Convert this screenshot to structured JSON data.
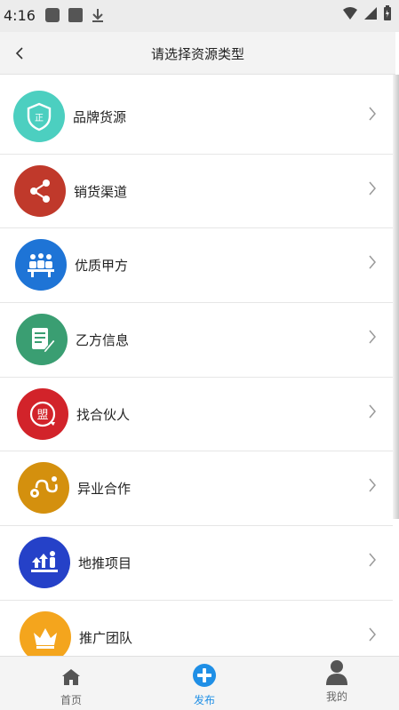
{
  "status_bar": {
    "time": "4:16"
  },
  "header": {
    "title": "请选择资源类型"
  },
  "items": [
    {
      "label": "品牌货源",
      "icon": "shield-certified-icon",
      "color": "#4ccfc0"
    },
    {
      "label": "销货渠道",
      "icon": "share-icon",
      "color": "#c0392b"
    },
    {
      "label": "优质甲方",
      "icon": "team-meeting-icon",
      "color": "#1e74d6"
    },
    {
      "label": "乙方信息",
      "icon": "document-edit-icon",
      "color": "#3a9e72"
    },
    {
      "label": "找合伙人",
      "icon": "alliance-seal-icon",
      "color": "#d2232a"
    },
    {
      "label": "异业合作",
      "icon": "route-pin-icon",
      "color": "#d4900e"
    },
    {
      "label": "地推项目",
      "icon": "growth-person-icon",
      "color": "#2541c8"
    },
    {
      "label": "推广团队",
      "icon": "crown-icon",
      "color": "#f4a51d"
    }
  ],
  "tabbar": {
    "tabs": [
      {
        "label": "首页",
        "icon": "home-icon"
      },
      {
        "label": "发布",
        "icon": "plus-circle-icon",
        "active": true
      },
      {
        "label": "我的",
        "icon": "user-icon"
      }
    ],
    "active_color": "#1f8fe6"
  }
}
